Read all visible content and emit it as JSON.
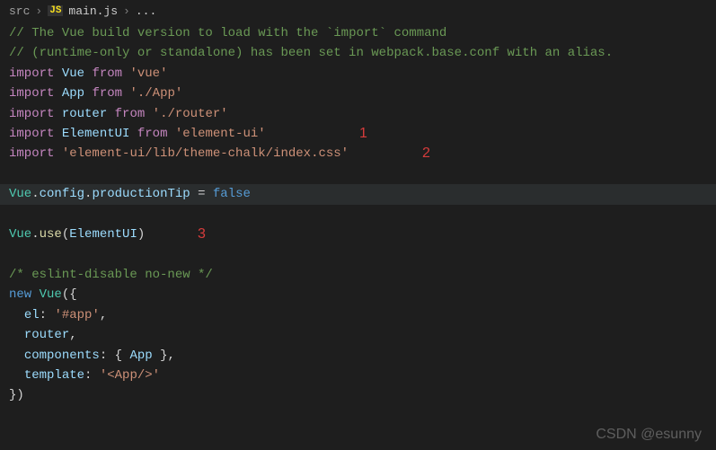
{
  "breadcrumb": {
    "folder": "src",
    "icon_label": "JS",
    "filename": "main.js",
    "trailing": "..."
  },
  "code": {
    "comment1_a": "// The Vue build version to load with the `",
    "comment1_b": "import",
    "comment1_c": "` command",
    "comment2": "// (runtime-only or standalone) has been set in webpack.base.conf with an alias.",
    "kw_import": "import",
    "kw_from": "from",
    "kw_new": "new",
    "kw_false": "false",
    "id_Vue": "Vue",
    "id_App": "App",
    "id_router": "router",
    "id_ElementUI": "ElementUI",
    "str_vue": "'vue'",
    "str_App": "'./App'",
    "str_router": "'./router'",
    "str_elementui": "'element-ui'",
    "str_elementcss": "'element-ui/lib/theme-chalk/index.css'",
    "prop_config": "config",
    "prop_productionTip": "productionTip",
    "fn_use": "use",
    "comment3": "/* eslint-disable no-new */",
    "prop_el": "el",
    "str_elval": "'#app'",
    "prop_components": "components",
    "prop_template": "template",
    "str_templateval": "'<App/>'"
  },
  "annotations": {
    "a1": "1",
    "a2": "2",
    "a3": "3"
  },
  "watermark": "CSDN @esunny"
}
